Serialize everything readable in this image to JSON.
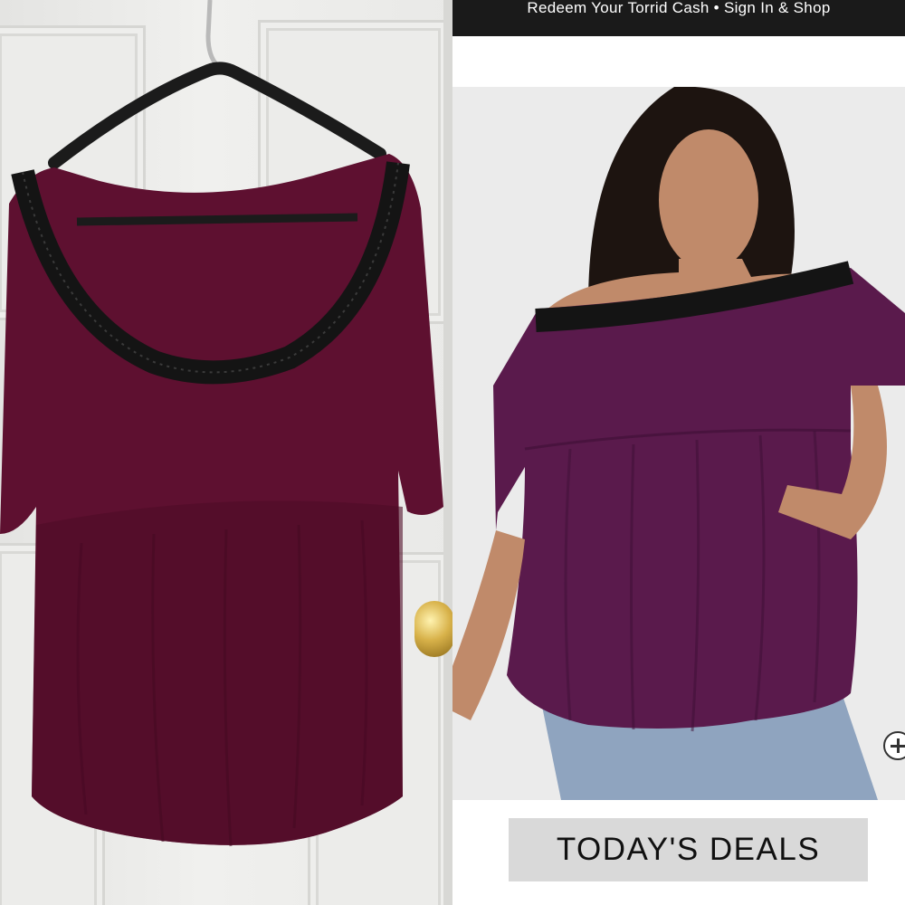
{
  "promo_bar": {
    "text": "Redeem Your Torrid Cash • Sign In & Shop"
  },
  "deals_banner": {
    "label": "TODAY'S DEALS"
  },
  "colors": {
    "top_burgundy": "#5e1030",
    "top_plum": "#5a1a4c",
    "lace_black": "#141414",
    "denim": "#8fa4bf",
    "promo_bg": "#1a1a1a",
    "deals_bg": "#d9d9d9"
  },
  "icons": {
    "zoom": "zoom-in-icon"
  }
}
